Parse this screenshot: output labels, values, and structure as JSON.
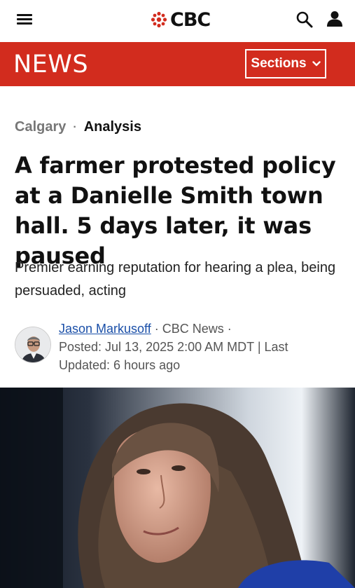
{
  "header": {
    "logo_text": "CBC",
    "menu_icon": "hamburger-menu-icon",
    "search_icon": "search-icon",
    "user_icon": "user-icon"
  },
  "news_bar": {
    "label": "NEWS",
    "sections_label": "Sections",
    "color": "#d22c1e"
  },
  "article": {
    "location": "Calgary",
    "separator": "·",
    "type": "Analysis",
    "headline": "A farmer protested policy at a Danielle Smith town hall. 5 days later, it was paused",
    "dek": "Premier earning reputation for hearing a plea, being persuaded, acting",
    "byline": {
      "author": "Jason Markusoff",
      "outlet_sep": "·",
      "outlet": "CBC News",
      "posted": "Posted: Jul 13, 2025 2:00 AM MDT | Last Updated: 6 hours ago"
    }
  }
}
